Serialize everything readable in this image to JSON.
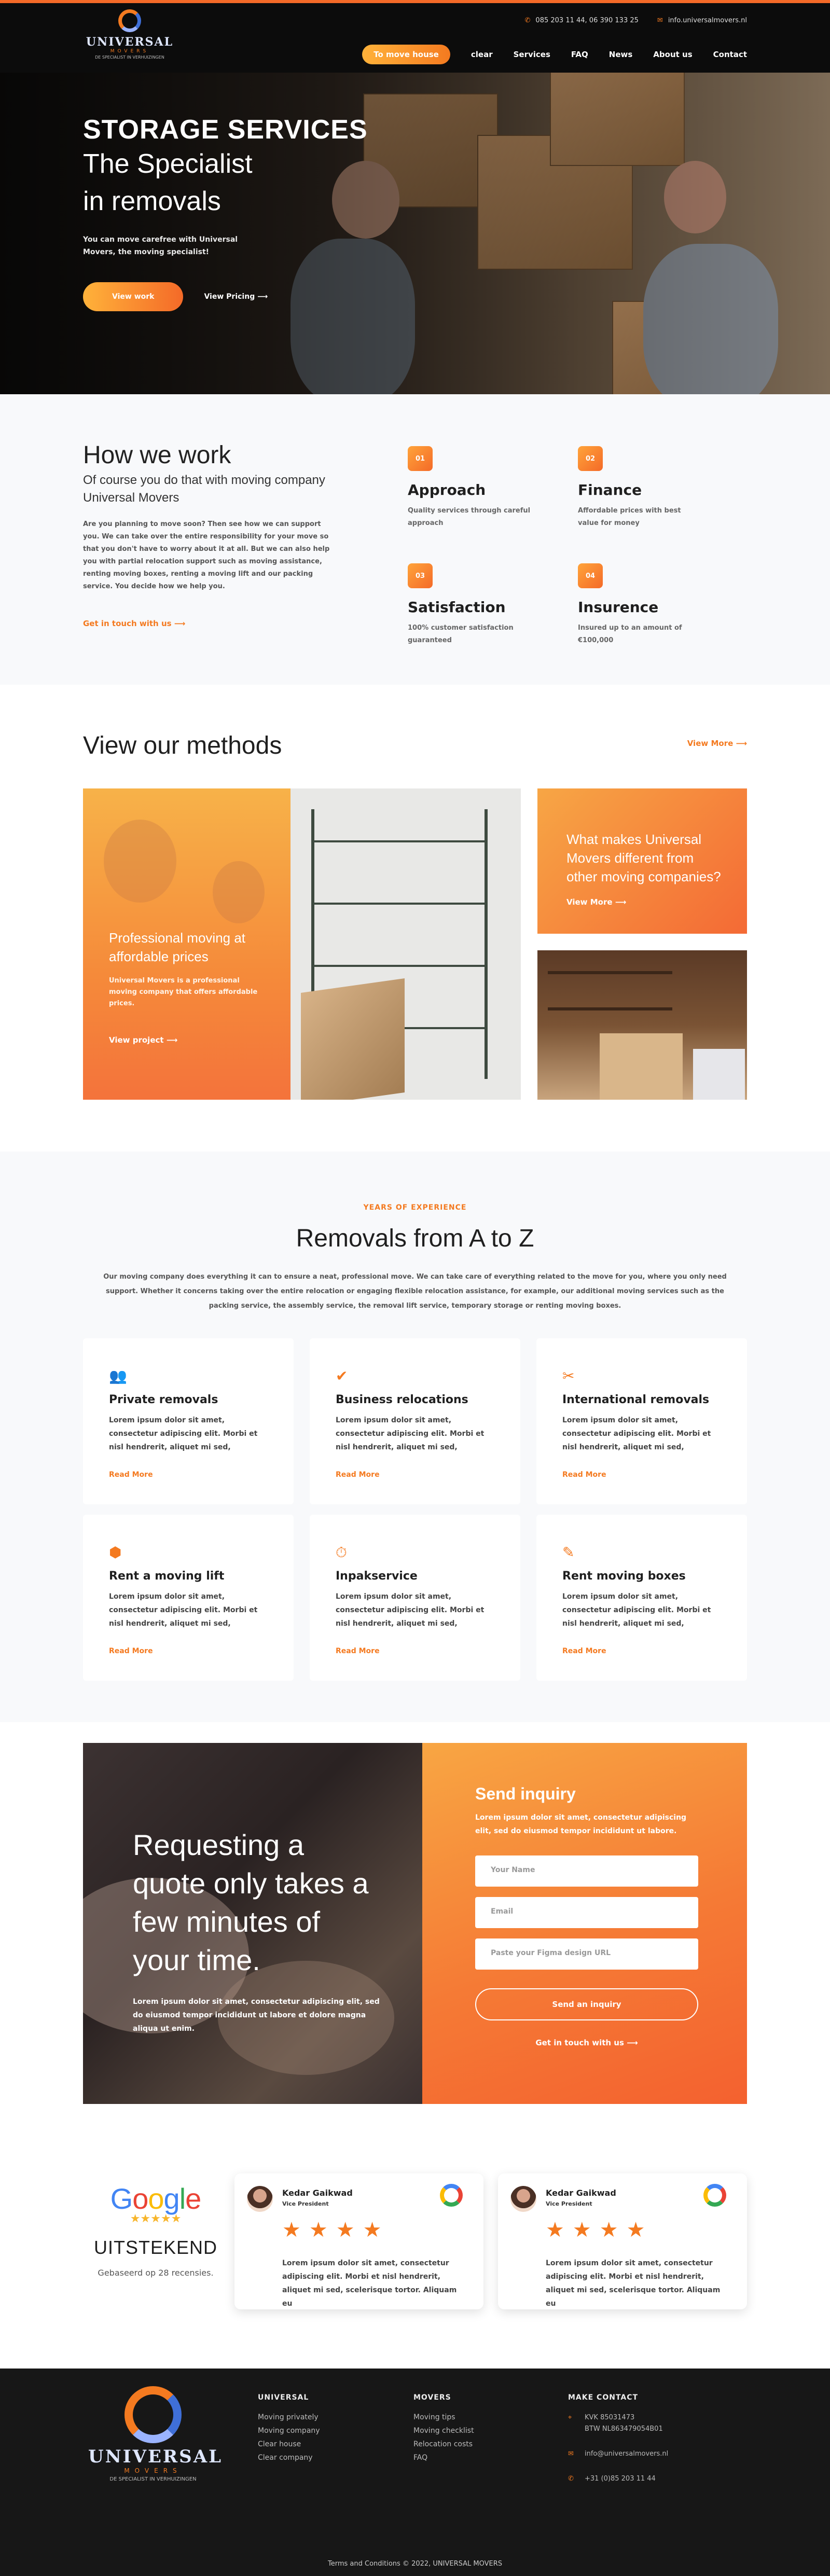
{
  "header": {
    "phone": "085 203 11 44, 06 390 133 25",
    "email": "info.universalmovers.nl",
    "logo": {
      "name": "UNIVERSAL",
      "sub": "MOVERS",
      "tagline": "DE SPECIALIST IN VERHUIZINGEN"
    },
    "nav": [
      "To move house",
      "clear",
      "Services",
      "FAQ",
      "News",
      "About us",
      "Contact"
    ]
  },
  "hero": {
    "title": "STORAGE SERVICES",
    "subtitle_line1": "The Specialist",
    "subtitle_line2": "in removals",
    "text": "You can move carefree with Universal Movers, the moving specialist!",
    "primary_button": "View work",
    "secondary_link": "View Pricing"
  },
  "how": {
    "title": "How we work",
    "subtitle": "Of course you do that with moving company Universal Movers",
    "text": "Are you planning to move soon? Then see how we can support you. We can take over the entire responsibility for your move so that you don't have to worry about it at all. But we can also help you with partial relocation support such as moving assistance, renting moving boxes, renting a moving lift and our packing service. You decide how we help you.",
    "link": "Get in touch with us",
    "features": [
      {
        "num": "01",
        "title": "Approach",
        "text": "Quality services through careful approach"
      },
      {
        "num": "02",
        "title": "Finance",
        "text": "Affordable prices with best value for money"
      },
      {
        "num": "03",
        "title": "Satisfaction",
        "text": "100% customer satisfaction guaranteed"
      },
      {
        "num": "04",
        "title": "Insurence",
        "text": "Insured up to an amount of €100,000"
      }
    ]
  },
  "methods": {
    "title": "View our methods",
    "view_more": "View More",
    "big_card": {
      "title": "Professional moving at affordable prices",
      "text": "Universal Movers is a professional moving company that offers affordable prices.",
      "link": "View project"
    },
    "side_card": {
      "title": "What makes Universal Movers different from other moving companies?",
      "link": "View More"
    }
  },
  "services": {
    "kicker": "YEARS OF EXPERIENCE",
    "title": "Removals from A to Z",
    "intro": "Our moving company does everything it can to ensure a neat, professional move. We can take care of everything related to the move for you, where you only need support. Whether it concerns taking over the entire relocation or engaging flexible relocation assistance, for example, our additional moving services such as the packing service, the assembly service, the removal lift service, temporary storage or renting moving boxes.",
    "cards": [
      {
        "icon": "people-icon",
        "title": "Private removals",
        "text": "Lorem ipsum dolor sit amet, consectetur adipiscing elit. Morbi et nisl hendrerit, aliquet mi sed,",
        "link": "Read More"
      },
      {
        "icon": "check-badge-icon",
        "title": "Business relocations",
        "text": "Lorem ipsum dolor sit amet, consectetur adipiscing elit. Morbi et nisl hendrerit, aliquet mi sed,",
        "link": "Read More"
      },
      {
        "icon": "tools-icon",
        "title": "International removals",
        "text": "Lorem ipsum dolor sit amet, consectetur adipiscing elit. Morbi et nisl hendrerit, aliquet mi sed,",
        "link": "Read More"
      },
      {
        "icon": "lift-icon",
        "title": "Rent a moving lift",
        "text": "Lorem ipsum dolor sit amet, consectetur adipiscing elit. Morbi et nisl hendrerit, aliquet mi sed,",
        "link": "Read More"
      },
      {
        "icon": "timer-icon",
        "title": "Inpakservice",
        "text": "Lorem ipsum dolor sit amet, consectetur adipiscing elit. Morbi et nisl hendrerit, aliquet mi sed,",
        "link": "Read More"
      },
      {
        "icon": "box-edit-icon",
        "title": "Rent moving boxes",
        "text": "Lorem ipsum dolor sit amet, consectetur adipiscing elit. Morbi et nisl hendrerit, aliquet mi sed,",
        "link": "Read More"
      }
    ]
  },
  "quote": {
    "title": "Requesting a quote only takes a few minutes of your time.",
    "text": "Lorem ipsum dolor sit amet, consectetur adipiscing elit, sed do eiusmod tempor incididunt ut labore et dolore magna aliqua ut enim.",
    "form": {
      "title": "Send inquiry",
      "text": "Lorem ipsum dolor sit amet, consectetur adipiscing elit, sed do eiusmod tempor incididunt ut labore.",
      "name_placeholder": "Your Name",
      "email_placeholder": "Email",
      "figma_placeholder": "Paste your Figma design URL",
      "submit": "Send an inquiry",
      "link": "Get in touch with us"
    }
  },
  "reviews": {
    "google_label": "Google",
    "google_stars": "★★★★★",
    "rating_word": "UITSTEKEND",
    "based_on": "Gebaseerd op 28 recensies.",
    "cards": [
      {
        "name": "Kedar Gaikwad",
        "role": "Vice President",
        "stars": "★★★★",
        "text": "Lorem ipsum dolor sit amet, consectetur adipiscing elit. Morbi et nisl hendrerit, aliquet mi sed, scelerisque tortor. Aliquam eu"
      },
      {
        "name": "Kedar Gaikwad",
        "role": "Vice President",
        "stars": "★★★★",
        "text": "Lorem ipsum dolor sit amet, consectetur adipiscing elit. Morbi et nisl hendrerit, aliquet mi sed, scelerisque tortor. Aliquam eu"
      }
    ]
  },
  "footer": {
    "col1": {
      "title": "UNIVERSAL",
      "items": [
        "Moving privately",
        "Moving company",
        "Clear house",
        "Clear company"
      ]
    },
    "col2": {
      "title": "MOVERS",
      "items": [
        "Moving tips",
        "Moving checklist",
        "Relocation costs",
        "FAQ"
      ]
    },
    "contact": {
      "title": "MAKE CONTACT",
      "kvk": "KVK 85031473",
      "btw": "BTW NL863479054B01",
      "email": "info@universalmovers.nl",
      "phone": "+31 (0)85 203 11 44"
    },
    "copyright": "Terms and Conditions © 2022, UNIVERSAL MOVERS"
  }
}
